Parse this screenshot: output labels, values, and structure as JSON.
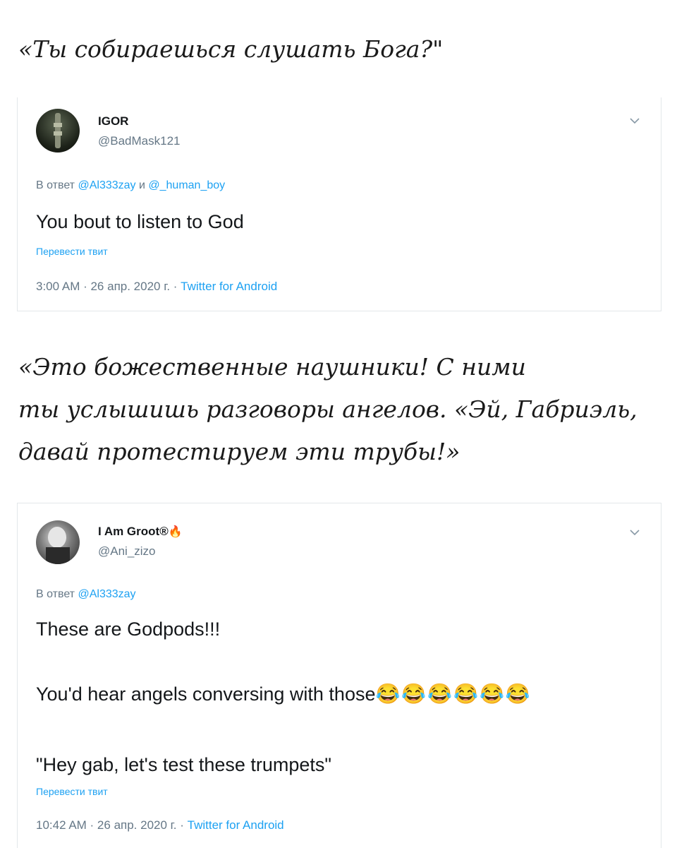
{
  "captions": [
    {
      "lines": [
        "«Ты собираешься слушать Бога?\""
      ]
    },
    {
      "lines": [
        "«Это божественные наушники! С ними",
        "ты услышишь разговоры ангелов. «Эй, Габриэль,",
        "давай протестируем эти трубы!»"
      ]
    }
  ],
  "tweets": [
    {
      "display_name": "IGOR",
      "handle": "@BadMask121",
      "reply_prefix": "В ответ",
      "reply_mention_1": "@Al333zay",
      "reply_joiner": "и",
      "reply_mention_2": "@_human_boy",
      "text": "You bout to listen to God",
      "translate_label": "Перевести твит",
      "time": "3:00 AM · 26 апр. 2020 г. · ",
      "source": "Twitter for Android"
    },
    {
      "display_name": "I Am Groot®",
      "name_emoji": "🔥",
      "handle": "@Ani_zizo",
      "reply_prefix": "В ответ",
      "reply_mention_1": "@Al333zay",
      "text_line_1": "These are Godpods!!!",
      "text_line_2": "You'd hear angels conversing with those",
      "text_emoji": "😂😂😂😂😂😂",
      "text_line_3": "\"Hey gab, let's test these trumpets\"",
      "translate_label": "Перевести твит",
      "time": "10:42 AM · 26 апр. 2020 г. · ",
      "source": "Twitter for Android"
    }
  ],
  "icons": {
    "menu": "chevron-down-icon",
    "avatar_1": "avatar-icon",
    "avatar_2": "avatar-icon"
  },
  "colors": {
    "link": "#1da1f2",
    "secondary": "#657786",
    "text": "#14171a",
    "border": "#e3e7ea"
  }
}
